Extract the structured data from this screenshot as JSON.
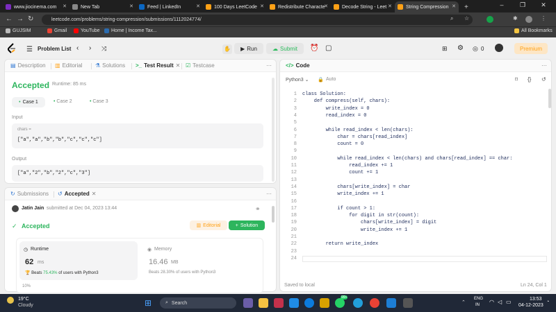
{
  "browser": {
    "tabs": [
      {
        "label": "www.jiocinema.com",
        "color": "#7b2cbf"
      },
      {
        "label": "New Tab",
        "color": "#888888"
      },
      {
        "label": "Feed | LinkedIn",
        "color": "#0a66c2"
      },
      {
        "label": "100 Days LeetCode",
        "color": "#ffa116"
      },
      {
        "label": "Redistribute Characte",
        "color": "#ffa116"
      },
      {
        "label": "Decode String - Leet",
        "color": "#ffa116"
      },
      {
        "label": "String Compression",
        "color": "#ffa116"
      }
    ],
    "url": "leetcode.com/problems/string-compression/submissions/1112024774/",
    "bookmarks": [
      "GUJSIM",
      "Gmail",
      "YouTube",
      "Home | Income Tax..."
    ],
    "all_bookmarks": "All Bookmarks"
  },
  "header": {
    "problem_list": "Problem List",
    "run": "Run",
    "submit": "Submit",
    "streak": "0",
    "premium": "Premium"
  },
  "left_top": {
    "tabs": [
      "Description",
      "Editorial",
      "Solutions",
      "Test Result",
      "Testcase"
    ],
    "status": "Accepted",
    "runtime": "Runtime: 85 ms",
    "cases": [
      "Case 1",
      "Case 2",
      "Case 3"
    ],
    "input_label": "Input",
    "input_var": "chars =",
    "input_value": "[\"a\",\"a\",\"b\",\"b\",\"c\",\"c\",\"c\"]",
    "output_label": "Output",
    "output_value": "[\"a\",\"2\",\"b\",\"2\",\"c\",\"3\"]"
  },
  "left_bottom": {
    "tabs": [
      "Submissions",
      "Accepted"
    ],
    "user": "Jatin Jain",
    "submitted": "submitted at Dec 04, 2023 13:44",
    "status": "Accepted",
    "editorial": "Editorial",
    "solution": "Solution",
    "runtime_label": "Runtime",
    "runtime_value": "62",
    "runtime_unit": "ms",
    "runtime_beats_pre": "Beats",
    "runtime_beats_pct": "75.43%",
    "runtime_beats_post": "of users with Python3",
    "memory_label": "Memory",
    "memory_value": "16.46",
    "memory_unit": "MB",
    "memory_beats": "Beats 28.30% of users with Python3",
    "axis_tick": "10%"
  },
  "code": {
    "title": "Code",
    "language": "Python3",
    "save": "Auto",
    "lines": [
      "class Solution:",
      "    def compress(self, chars):",
      "        write_index = 0",
      "        read_index = 0",
      "",
      "        while read_index < len(chars):",
      "            char = chars[read_index]",
      "            count = 0",
      "",
      "            while read_index < len(chars) and chars[read_index] == char:",
      "                read_index += 1",
      "                count += 1",
      "",
      "            chars[write_index] = char",
      "            write_index += 1",
      "",
      "            if count > 1:",
      "                for digit in str(count):",
      "                    chars[write_index] = digit",
      "                    write_index += 1",
      "",
      "        return write_index",
      "",
      ""
    ],
    "status_left": "Saved to local",
    "status_right": "Ln 24, Col 1"
  },
  "taskbar": {
    "weather_temp": "19°C",
    "weather_desc": "Cloudy",
    "search": "Search",
    "badge": "99+",
    "lang1": "ENG",
    "lang2": "IN",
    "time": "13:53",
    "date": "04-12-2023"
  }
}
